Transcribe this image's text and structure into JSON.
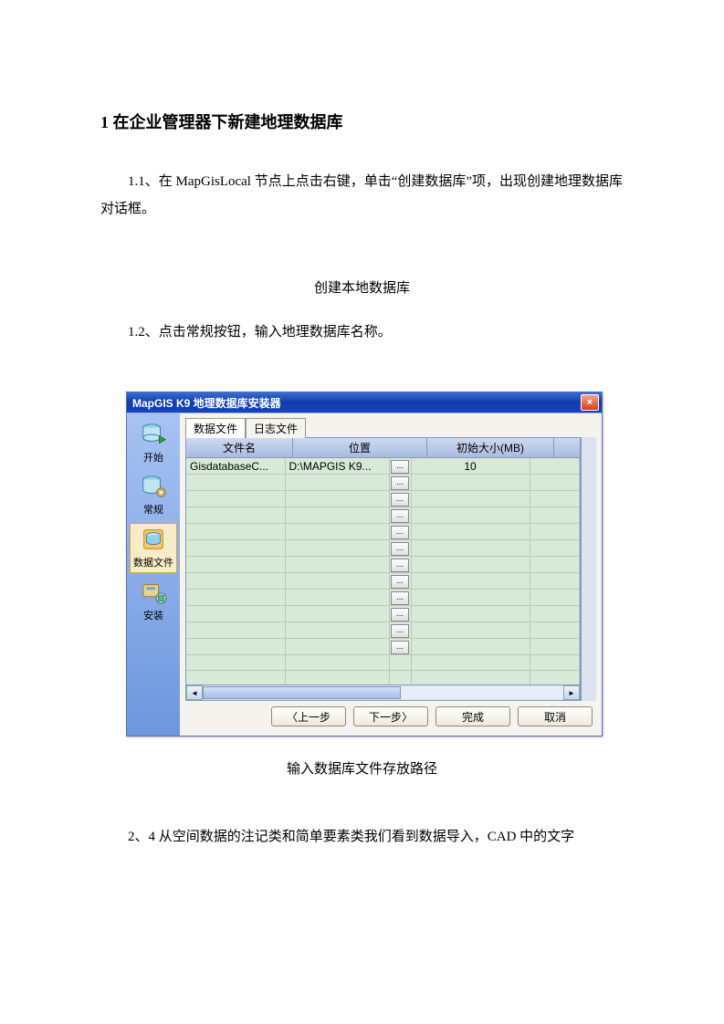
{
  "heading": "1 在企业管理器下新建地理数据库",
  "p1": "1.1、在 MapGisLocal 节点上点击右键，单击“创建数据库”项，出现创建地理数据库对话框。",
  "caption1": "创建本地数据库",
  "p2": "1.2、点击常规按钮，输入地理数据库名称。",
  "caption2": "输入数据库文件存放路径",
  "p3": "2、4 从空间数据的注记类和简单要素类我们看到数据导入，CAD 中的文字",
  "window": {
    "title": "MapGIS K9 地理数据库安装器",
    "close": "×",
    "sidebar": [
      {
        "label": "开始"
      },
      {
        "label": "常规"
      },
      {
        "label": "数据文件"
      },
      {
        "label": "安装"
      }
    ],
    "tabs": {
      "data": "数据文件",
      "log": "日志文件"
    },
    "cols": {
      "file": "文件名",
      "loc": "位置",
      "size": "初始大小(MB)"
    },
    "row": {
      "file": "GisdatabaseC...",
      "loc": "D:\\MAPGIS K9...",
      "btn": "...",
      "size": "10"
    },
    "buttons": {
      "prev": "〈上一步",
      "next": "下一步〉",
      "finish": "完成",
      "cancel": "取消"
    }
  }
}
